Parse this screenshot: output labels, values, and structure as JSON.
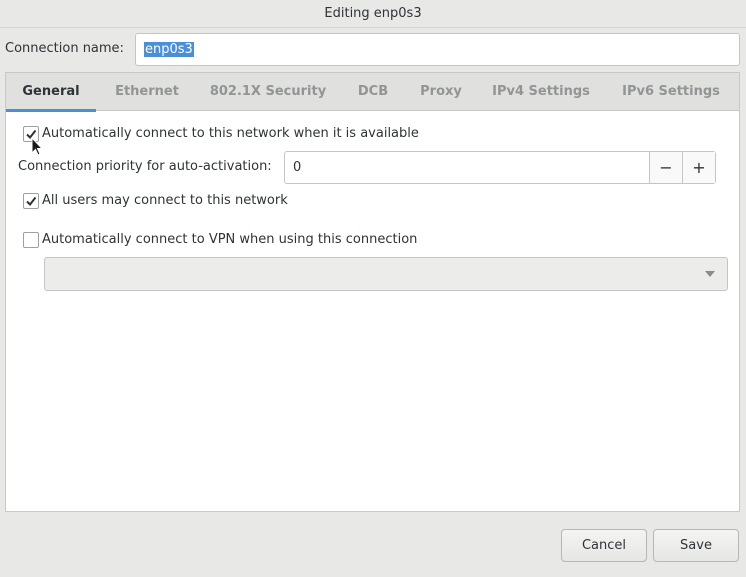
{
  "window": {
    "title": "Editing enp0s3"
  },
  "connection": {
    "label": "Connection name:",
    "value": "enp0s3"
  },
  "tabs": [
    {
      "label": "General",
      "active": true
    },
    {
      "label": "Ethernet",
      "active": false
    },
    {
      "label": "802.1X Security",
      "active": false
    },
    {
      "label": "DCB",
      "active": false
    },
    {
      "label": "Proxy",
      "active": false
    },
    {
      "label": "IPv4 Settings",
      "active": false
    },
    {
      "label": "IPv6 Settings",
      "active": false
    }
  ],
  "general": {
    "auto_connect": {
      "label": "Automatically connect to this network when it is available",
      "checked": true
    },
    "priority": {
      "label": "Connection priority for auto-activation:",
      "value": "0",
      "minus": "−",
      "plus": "+"
    },
    "all_users": {
      "label": "All users may connect to this network",
      "checked": true
    },
    "auto_vpn": {
      "label": "Automatically connect to VPN when using this connection",
      "checked": false
    },
    "vpn_select": {
      "value": ""
    }
  },
  "buttons": {
    "cancel": "Cancel",
    "save": "Save"
  },
  "colors": {
    "accent": "#4a90d9",
    "background": "#e8e8e7"
  }
}
